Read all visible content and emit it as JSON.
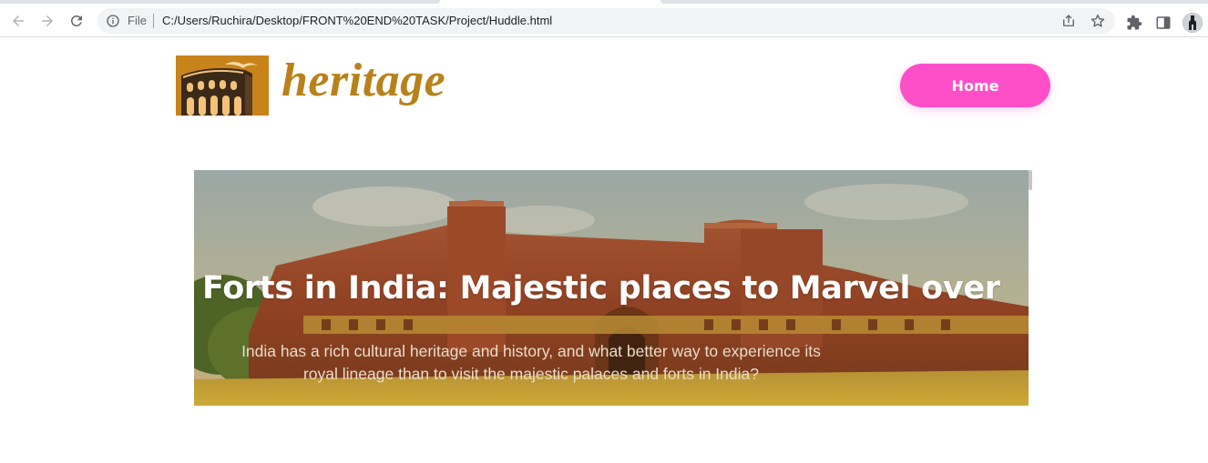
{
  "browser": {
    "omnibox": {
      "scheme_label": "File",
      "url": "C:/Users/Ruchira/Desktop/FRONT%20END%20TASK/Project/Huddle.html"
    },
    "icons": [
      "back-arrow-icon",
      "forward-arrow-icon",
      "reload-icon",
      "info-icon",
      "share-icon",
      "star-icon",
      "extensions-icon",
      "side-panel-icon",
      "profile-avatar"
    ]
  },
  "header": {
    "logo_text": "heritage",
    "nav": {
      "home_label": "Home"
    }
  },
  "hero": {
    "title": "Forts in India: Majestic places to Marvel over",
    "subtitle": "India has a rich cultural heritage and history, and what better way to experience its royal lineage than to visit the majestic palaces and forts in India?"
  },
  "colors": {
    "brand_gold": "#b8821b",
    "home_button": "#ff4fc8",
    "fort_red": "#a2452a"
  }
}
